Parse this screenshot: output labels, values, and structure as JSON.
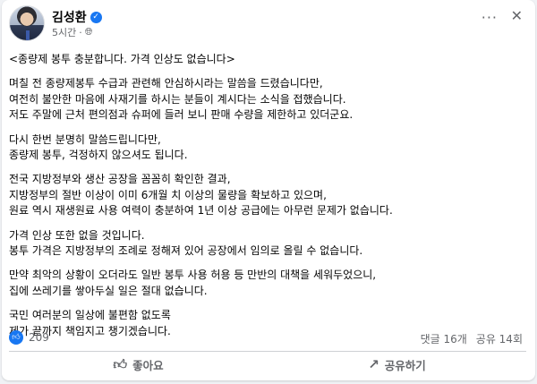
{
  "post": {
    "author": "김성환",
    "time": "5시간",
    "visibility_icon": "globe-icon",
    "paragraphs": [
      [
        "<종량제 봉투 충분합니다. 가격 인상도 없습니다>"
      ],
      [
        "며칠 전 종량제봉투 수급과 관련해 안심하시라는 말씀을 드렸습니다만,",
        "여전히 불안한 마음에 사재기를 하시는 분들이 계시다는 소식을 접했습니다.",
        "저도 주말에 근처 편의점과 슈퍼에 들러 보니 판매 수량을 제한하고 있더군요."
      ],
      [
        "다시 한번 분명히 말씀드립니다만,",
        "종량제 봉투, 걱정하지 않으셔도 됩니다."
      ],
      [
        "전국 지방정부와 생산 공장을 꼼꼼히 확인한 결과,",
        "지방정부의 절반 이상이 이미 6개월 치 이상의 물량을 확보하고 있으며,",
        "원료 역시 재생원료 사용 여력이 충분하여 1년 이상 공급에는 아무런 문제가 없습니다."
      ],
      [
        "가격 인상 또한 없을 것입니다.",
        "봉투 가격은 지방정부의 조례로 정해져 있어 공장에서 임의로 올릴 수 없습니다."
      ],
      [
        "만약 최악의 상황이 오더라도 일반 봉투 사용 허용 등 만반의 대책을 세워두었으니,",
        "집에 쓰레기를 쌓아두실 일은 절대 없습니다."
      ],
      [
        "국민 여러분의 일상에 불편함 없도록",
        "제가 끝까지 책임지고 챙기겠습니다."
      ]
    ]
  },
  "stats": {
    "likes": "209",
    "comments": "댓글 16개",
    "shares": "공유 14회"
  },
  "actions": {
    "like": "좋아요",
    "share": "공유하기"
  },
  "colors": {
    "accent": "#1877f2",
    "muted": "#65676b",
    "background": "#f0f2f5"
  }
}
